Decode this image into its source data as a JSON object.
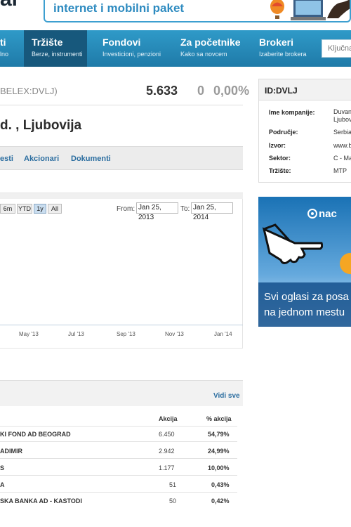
{
  "header": {
    "logo_fragment": "al",
    "ad_text": "internet i mobilni paket"
  },
  "nav": {
    "items": [
      {
        "title": "ti",
        "sub": "lno"
      },
      {
        "title": "Tržište",
        "sub": "Berze, instrumenti"
      },
      {
        "title": "Fondovi",
        "sub": "Investicioni, penzioni"
      },
      {
        "title": "Za početnike",
        "sub": "Kako sa novcem"
      },
      {
        "title": "Brokeri",
        "sub": "Izaberite brokera"
      }
    ],
    "search_placeholder": "Ključna"
  },
  "ticker": {
    "code": "BELEX:DVLJ)",
    "price": "5.633",
    "change": "0",
    "change_pct": "0,00%"
  },
  "company": {
    "title": "d. , Ljubovija"
  },
  "tabs": [
    "esti",
    "Akcionari",
    "Dokumenti"
  ],
  "chart": {
    "range_buttons": [
      "6m",
      "YTD",
      "1y",
      "All"
    ],
    "selected_range": "1y",
    "from_label": "From:",
    "from_value": "Jan 25, 2013",
    "to_label": "To:",
    "to_value": "Jan 25, 2014",
    "x_ticks": [
      "May '13",
      "Jul '13",
      "Sep '13",
      "Nov '13",
      "Jan '14"
    ]
  },
  "holders": {
    "see_all": "Vidi sve",
    "col_shares": "Akcija",
    "col_pct": "% akcija",
    "rows": [
      {
        "name": "KI FOND AD BEOGRAD",
        "shares": "6.450",
        "pct": "54,79%"
      },
      {
        "name": "ADIMIR",
        "shares": "2.942",
        "pct": "24,99%"
      },
      {
        "name": "S",
        "shares": "1.177",
        "pct": "10,00%"
      },
      {
        "name": "A",
        "shares": "51",
        "pct": "0,43%"
      },
      {
        "name": "SKA BANKA AD - KASTODI",
        "shares": "50",
        "pct": "0,42%"
      }
    ]
  },
  "id_panel": {
    "title": "ID:DVLJ",
    "rows": [
      {
        "label": "Ime kompanije:",
        "value": "Duvan Ljubov"
      },
      {
        "label": "Područje:",
        "value": "Serbia"
      },
      {
        "label": "Izvor:",
        "value": "www.b"
      },
      {
        "label": "Sektor:",
        "value": "C - Ma"
      },
      {
        "label": "Tržište:",
        "value": "MTP"
      }
    ]
  },
  "side_ad": {
    "brand": "nac",
    "line1": "Svi oglasi za posa",
    "line2": "na jednom mestu"
  },
  "colors": {
    "nav_blue": "#2f9ac8",
    "nav_active": "#17587c",
    "link_blue": "#2c6ea0"
  }
}
